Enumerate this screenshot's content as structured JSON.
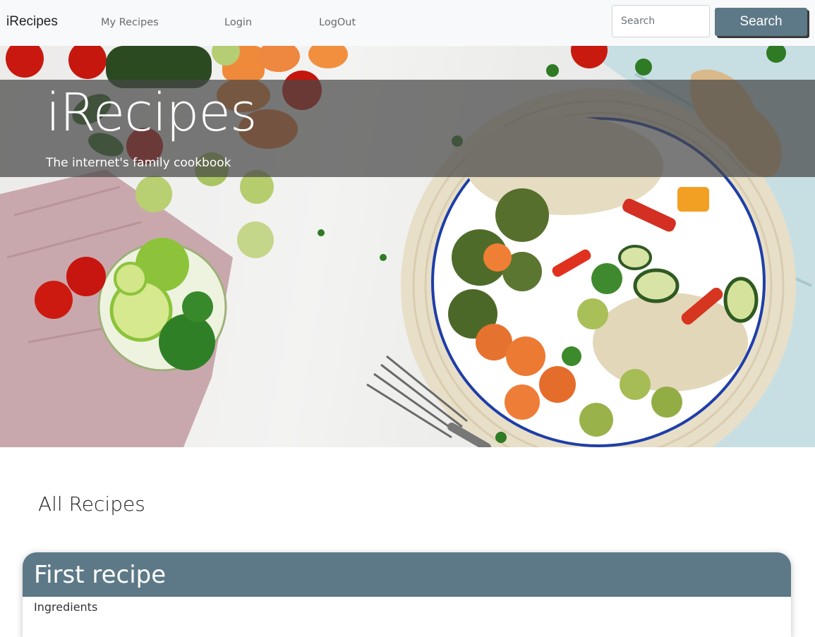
{
  "navbar": {
    "brand": "iRecipes",
    "links": [
      "My Recipes",
      "Login",
      "LogOut"
    ],
    "search_placeholder": "Search",
    "search_button": "Search"
  },
  "hero": {
    "title": "iRecipes",
    "subtitle": "The internet's family cookbook"
  },
  "main": {
    "section_title": "All Recipes",
    "recipes": [
      {
        "title": "First recipe",
        "ingredients_label": "Ingredients"
      }
    ]
  },
  "colors": {
    "accent": "#5d7987",
    "navbar_bg": "#f8f9fa",
    "hero_overlay": "#464646"
  }
}
